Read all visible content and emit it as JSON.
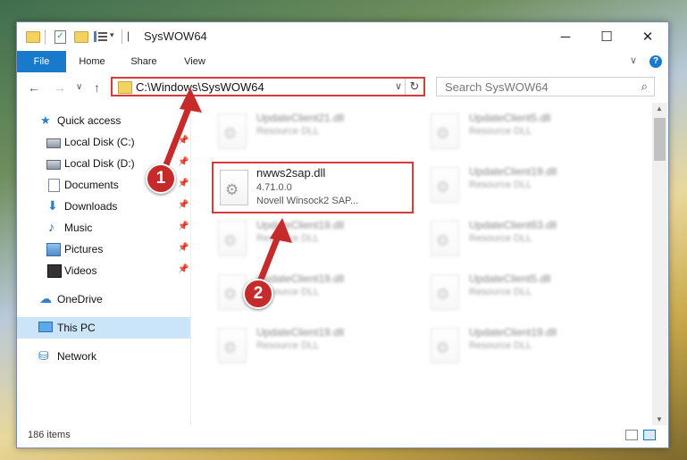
{
  "window": {
    "title": "SysWOW64",
    "controls": {
      "minimize": "─",
      "maximize": "☐",
      "close": "✕"
    }
  },
  "ribbon": {
    "tabs": [
      "File",
      "Home",
      "Share",
      "View"
    ],
    "collapse_glyph": "∨",
    "help_glyph": "?"
  },
  "nav": {
    "back": "←",
    "forward": "→",
    "recent": "∨",
    "up": "↑",
    "address": "C:\\Windows\\SysWOW64",
    "address_dropdown": "∨",
    "refresh": "↻",
    "search_placeholder": "Search SysWOW64"
  },
  "sidebar": {
    "items": [
      {
        "label": "Quick access",
        "icon": "star-icon",
        "pinned": false
      },
      {
        "label": "Local Disk (C:)",
        "icon": "drive-icon",
        "pinned": true
      },
      {
        "label": "Local Disk (D:)",
        "icon": "drive-icon",
        "pinned": true
      },
      {
        "label": "Documents",
        "icon": "documents-icon",
        "pinned": true
      },
      {
        "label": "Downloads",
        "icon": "download-icon",
        "pinned": true
      },
      {
        "label": "Music",
        "icon": "music-icon",
        "pinned": true
      },
      {
        "label": "Pictures",
        "icon": "pictures-icon",
        "pinned": true
      },
      {
        "label": "Videos",
        "icon": "videos-icon",
        "pinned": true
      },
      {
        "label": "OneDrive",
        "icon": "cloud-icon",
        "pinned": false
      },
      {
        "label": "This PC",
        "icon": "computer-icon",
        "pinned": false,
        "selected": true
      },
      {
        "label": "Network",
        "icon": "network-icon",
        "pinned": false
      }
    ],
    "pin_glyph": "📌"
  },
  "files": [
    {
      "name": "UpdateClient21.dll",
      "desc": "Resource DLL",
      "blurred": true
    },
    {
      "name": "UpdateClient5.dll",
      "desc": "Resource DLL",
      "blurred": true
    },
    {
      "name": "nwws2sap.dll",
      "desc": "4.71.0.0",
      "extra": "Novell Winsock2 SAP...",
      "blurred": false,
      "highlighted": true
    },
    {
      "name": "UpdateClient19.dll",
      "desc": "Resource DLL",
      "blurred": true
    },
    {
      "name": "UpdateClient19.dll",
      "desc": "Resource DLL",
      "blurred": true
    },
    {
      "name": "UpdateClient63.dll",
      "desc": "Resource DLL",
      "blurred": true
    },
    {
      "name": "UpdateClient19.dll",
      "desc": "Resource DLL",
      "blurred": true
    },
    {
      "name": "UpdateClient5.dll",
      "desc": "Resource DLL",
      "blurred": true
    },
    {
      "name": "UpdateClient19.dll",
      "desc": "Resource DLL",
      "blurred": true
    },
    {
      "name": "UpdateClient19.dll",
      "desc": "Resource DLL",
      "blurred": true
    }
  ],
  "status": {
    "item_count": "186 items"
  },
  "callouts": [
    {
      "number": "1",
      "target": "address bar"
    },
    {
      "number": "2",
      "target": "nwws2sap.dll"
    }
  ],
  "colors": {
    "accent": "#1979ca",
    "highlight": "#d93a3a",
    "selected": "#cce4f7"
  }
}
